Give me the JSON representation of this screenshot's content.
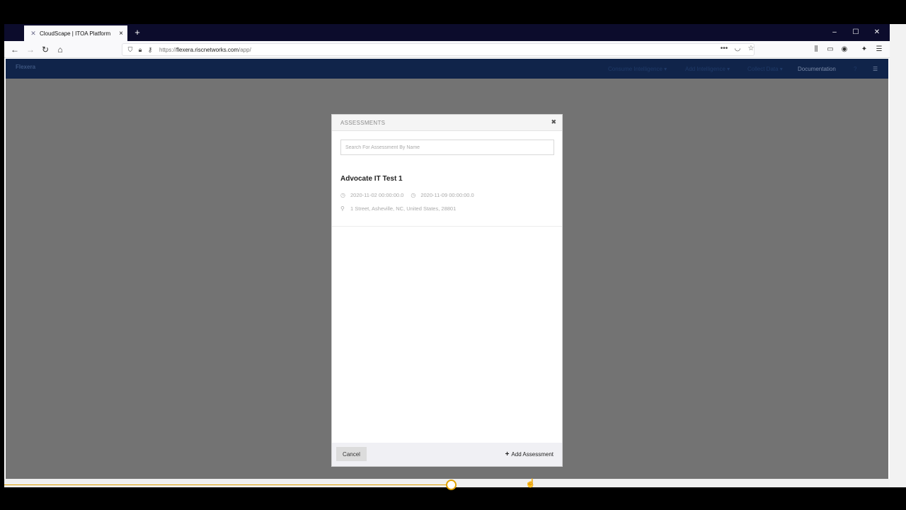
{
  "browser": {
    "tab_title": "CloudScape | ITOA Platform",
    "tab_icon": "x-logo-icon",
    "url_prefix": "https://",
    "url_host": "flexera.riscnetworks.com",
    "url_path": "/app/"
  },
  "app": {
    "logo": "Flexera",
    "nav": [
      {
        "label": "Consume Intelligence ▾"
      },
      {
        "label": "Add Intelligence ▾"
      },
      {
        "label": "Collect Data ▾"
      },
      {
        "label": "Documentation"
      }
    ]
  },
  "modal": {
    "title": "ASSESSMENTS",
    "search_placeholder": "Search For Assessment By Name",
    "assessment": {
      "name": "Advocate IT Test 1",
      "start": "2020-11-02 00:00:00.0",
      "end": "2020-11-09 00:00:00.0",
      "address": "1 Street, Asheville, NC, United States, 28801"
    },
    "cancel_label": "Cancel",
    "add_label": "Add Assessment"
  },
  "colors": {
    "header": "#10244a",
    "overlay": "#737373",
    "accent": "#e0a100"
  }
}
